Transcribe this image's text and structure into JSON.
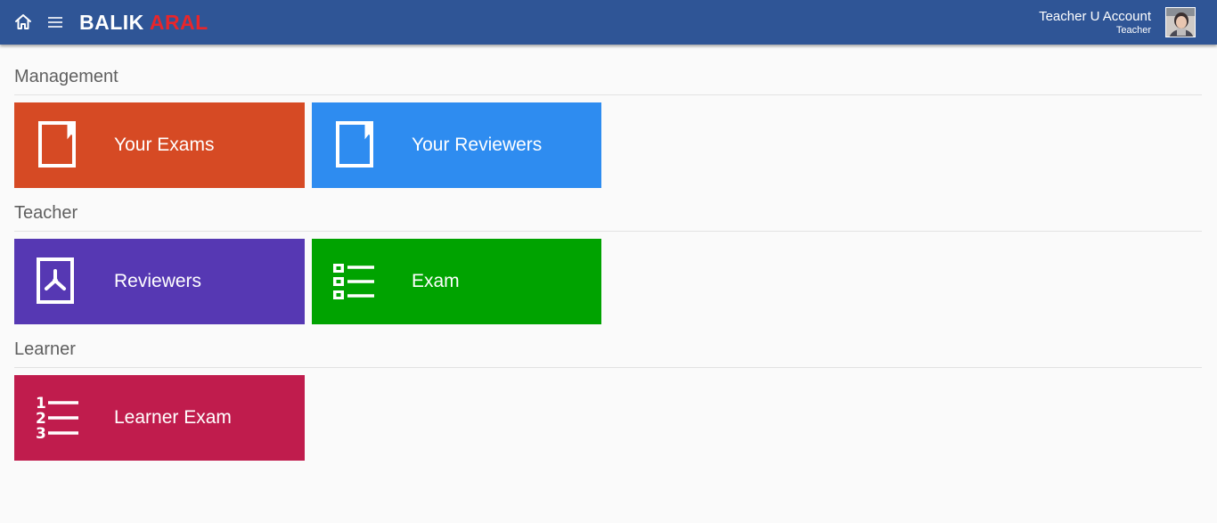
{
  "header": {
    "brand_part1": "BALIK",
    "brand_part2": "ARAL",
    "account_name": "Teacher U Account",
    "account_role": "Teacher",
    "icons": {
      "home": "home-icon",
      "menu": "hamburger-menu-icon"
    },
    "colors": {
      "bar": "#2f5596",
      "brand_accent": "#e8262b"
    }
  },
  "sections": [
    {
      "title": "Management",
      "tiles": [
        {
          "label": "Your Exams",
          "icon": "book-icon",
          "color": "#d64a24"
        },
        {
          "label": "Your Reviewers",
          "icon": "book-icon",
          "color": "#2e8cf0"
        }
      ]
    },
    {
      "title": "Teacher",
      "tiles": [
        {
          "label": "Reviewers",
          "icon": "pdf-document-icon",
          "color": "#5638b3"
        },
        {
          "label": "Exam",
          "icon": "checklist-icon",
          "color": "#00a300"
        }
      ]
    },
    {
      "title": "Learner",
      "tiles": [
        {
          "label": "Learner Exam",
          "icon": "numbered-list-icon",
          "color": "#c01c4d"
        }
      ]
    }
  ]
}
